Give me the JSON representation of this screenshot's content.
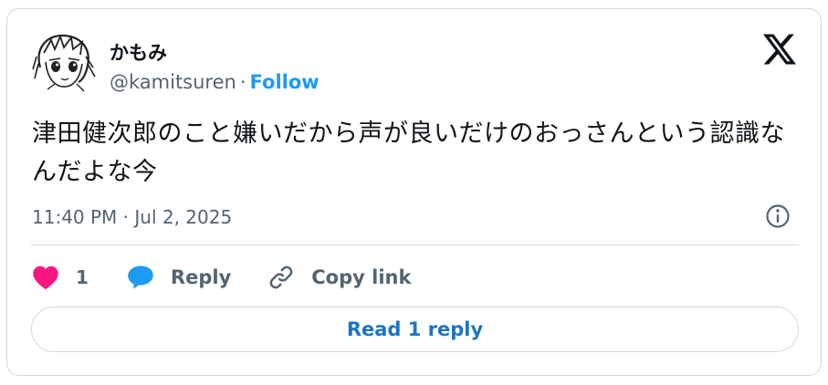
{
  "author": {
    "display_name": "かもみ",
    "handle": "@kamitsuren",
    "separator": "·",
    "follow_label": "Follow",
    "avatar_icon": "manga-character-avatar"
  },
  "brand": {
    "logo_icon": "x-logo-icon"
  },
  "tweet": {
    "text": "津田健次郎のこと嫌いだから声が良いだけのおっさんという認識なんだよな今",
    "timestamp": "11:40 PM · Jul 2, 2025"
  },
  "actions": {
    "like_count": "1",
    "reply_label": "Reply",
    "copy_link_label": "Copy link"
  },
  "footer": {
    "read_replies_label": "Read 1 reply"
  },
  "colors": {
    "accent": "#1d9bf0",
    "read_reply_text": "#1d74c2",
    "like": "#f91880",
    "muted": "#536471",
    "border": "#cfd9de",
    "text": "#0f1419"
  }
}
